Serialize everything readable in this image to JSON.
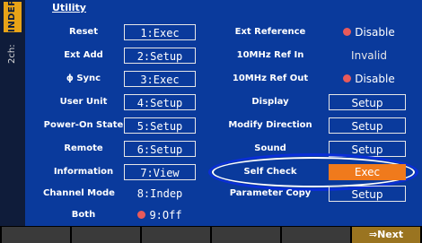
{
  "sidebar": {
    "mode": "INDEP",
    "channel": "2ch:"
  },
  "title": "Utility",
  "left_rows": [
    {
      "label": "Reset",
      "value": "1:Exec",
      "boxed": true
    },
    {
      "label": "Ext Add",
      "value": "2:Setup",
      "boxed": true
    },
    {
      "label": "ϕ Sync",
      "value": "3:Exec",
      "boxed": true
    },
    {
      "label": "User Unit",
      "value": "4:Setup",
      "boxed": true
    },
    {
      "label": "Power-On State",
      "value": "5:Setup",
      "boxed": true
    },
    {
      "label": "Remote",
      "value": "6:Setup",
      "boxed": true
    },
    {
      "label": "Information",
      "value": "7:View",
      "boxed": true
    },
    {
      "label": "Channel Mode",
      "value": "8:Indep",
      "boxed": false
    },
    {
      "label": "Both",
      "value": "9:Off",
      "boxed": false
    }
  ],
  "right_rows": [
    {
      "label": "Ext Reference",
      "value": "Disable"
    },
    {
      "label": "10MHz Ref In",
      "value": "Invalid"
    },
    {
      "label": "10MHz Ref Out",
      "value": "Disable"
    },
    {
      "label": "Display",
      "value": "Setup"
    },
    {
      "label": "Modify Direction",
      "value": "Setup"
    },
    {
      "label": "Sound",
      "value": "Setup"
    },
    {
      "label": "Self Check",
      "value": "Exec"
    },
    {
      "label": "Parameter Copy",
      "value": "Setup"
    }
  ],
  "softkeys": {
    "next_label": "⇒Next"
  },
  "colors": {
    "background": "#0a3a9c",
    "highlight": "#f07a1c",
    "indicator": "#e85a5a",
    "sidebar_tag": "#e8a317"
  }
}
